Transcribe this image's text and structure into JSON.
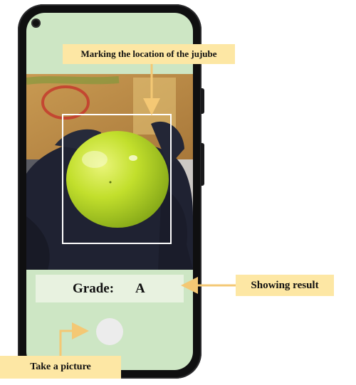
{
  "annotations": {
    "top": "Marking the location of the jujube",
    "result": "Showing result",
    "picture": "Take a picture"
  },
  "result": {
    "grade_label": "Grade:",
    "grade_value": "A"
  },
  "colors": {
    "screen_bg": "#cde6c4",
    "callout_bg": "#fde7a4",
    "arrow": "#f4c874",
    "grade_box_bg": "#e8f2e0",
    "phone_body": "#0f0f10",
    "jujube": "#b7d92a"
  },
  "icons": {
    "camera": "front-camera-icon",
    "shutter": "shutter-button"
  }
}
